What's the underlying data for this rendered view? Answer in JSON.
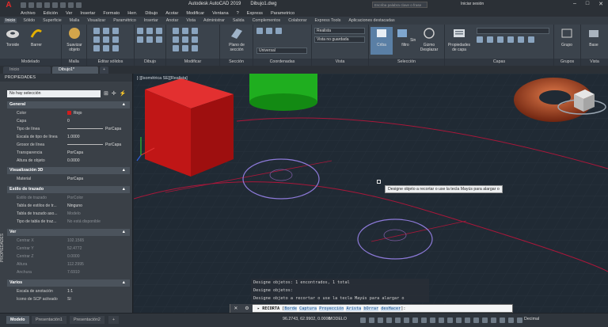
{
  "app": {
    "title": "Autodesk AutoCAD 2019",
    "file": "Dibujo1.dwg",
    "search_placeholder": "Escriba palabra clave o frase",
    "signin": "Iniciar sesión",
    "logo": "A"
  },
  "menu": [
    "Archivo",
    "Edición",
    "Ver",
    "Insertar",
    "Formato",
    "Herr.",
    "Dibujo",
    "Acotar",
    "Modificar",
    "Ventana",
    "?",
    "Express",
    "Parametrico"
  ],
  "ribbon_tabs": [
    "Inicio",
    "Sólido",
    "Superficie",
    "Malla",
    "Visualizar",
    "Paramétrico",
    "Insertar",
    "Anotar",
    "Vista",
    "Administrar",
    "Salida",
    "Complementos",
    "Colaborar",
    "Express Tools",
    "Aplicaciones destacadas"
  ],
  "ribbon": {
    "tools": {
      "toroide": "Toroide",
      "barrer": "Barrer",
      "suavizar": "Suavizar objeto",
      "plano": "Plano de sección",
      "criba": "Criba",
      "sin_filtro": "Sin filtro",
      "gizmo": "Gizmo Desplazar",
      "propiedades": "Propiedades de capa",
      "grupo": "Grupo",
      "base": "Base"
    },
    "panels": [
      "Modelado",
      "Malla",
      "Editar sólidos",
      "Dibujo",
      "Modificar",
      "Sección",
      "Coordenadas",
      "Vista",
      "Selección",
      "Capas",
      "Grupos",
      "Vista"
    ],
    "combos": {
      "visual_style": "Realista",
      "view": "Vista no guardada",
      "ucs": "Universal"
    }
  },
  "doc_tabs": [
    "Inicio",
    "Dibujo1*"
  ],
  "props": {
    "title": "PROPIEDADES",
    "selection": "No hay selección",
    "sections": [
      {
        "name": "General",
        "rows": [
          [
            "Color",
            "Rojo"
          ],
          [
            "Capa",
            "0"
          ],
          [
            "Tipo de línea",
            "PorCapa"
          ],
          [
            "Escala de tipo de línea",
            "1.0000"
          ],
          [
            "Grosor de línea",
            "PorCapa"
          ],
          [
            "Transparencia",
            "PorCapa"
          ],
          [
            "Altura de objeto",
            "0.0000"
          ]
        ]
      },
      {
        "name": "Visualización 3D",
        "rows": [
          [
            "Material",
            "PorCapa"
          ]
        ]
      },
      {
        "name": "Estilo de trazado",
        "rows": [
          [
            "Estilo de trazado",
            "PorColor"
          ],
          [
            "Tabla de estilos de tr...",
            "Ninguno"
          ],
          [
            "Tabla de trazado aso...",
            "Modelo"
          ],
          [
            "Tipo de tabla de traz...",
            "No está disponible"
          ]
        ]
      },
      {
        "name": "Ver",
        "rows": [
          [
            "Centrar X",
            "102.1565"
          ],
          [
            "Centrar Y",
            "52.4772"
          ],
          [
            "Centrar Z",
            "0.0000"
          ],
          [
            "Altura",
            "112.2995"
          ],
          [
            "Anchura",
            "7.6910"
          ]
        ]
      },
      {
        "name": "Varios",
        "rows": [
          [
            "Escala de anotación",
            "1:1"
          ],
          [
            "Icono de SCP activado",
            "Sí"
          ]
        ]
      }
    ]
  },
  "viewport": {
    "label": "[-][Isométrica SE][Realista]"
  },
  "tooltip": "Designe objeto a recortar o use la tecla Mayús para alargar o",
  "command": {
    "history": [
      "Designe objetos: 1 encontrados, 1 total",
      "Designe objetos:",
      "Designe objeto a recortar o use la tecla Mayús para alargar o"
    ],
    "prefix": "RECORTA",
    "options": [
      "Borde",
      "Captura",
      "Proyección",
      "Arista",
      "bOrrar",
      "desHacer"
    ]
  },
  "status": {
    "layout_tabs": [
      "Modelo",
      "Presentación1",
      "Presentación2"
    ],
    "coords": "96.2743, 62.9902, 0.0000",
    "mode": "MODELO",
    "units": "Decimal"
  },
  "colors": {
    "cube": "#d31a1a",
    "cylinder": "#1fb21f",
    "torus": "#a8481c",
    "circle": "#8d7ad9",
    "trim_line": "#c11b3a"
  }
}
